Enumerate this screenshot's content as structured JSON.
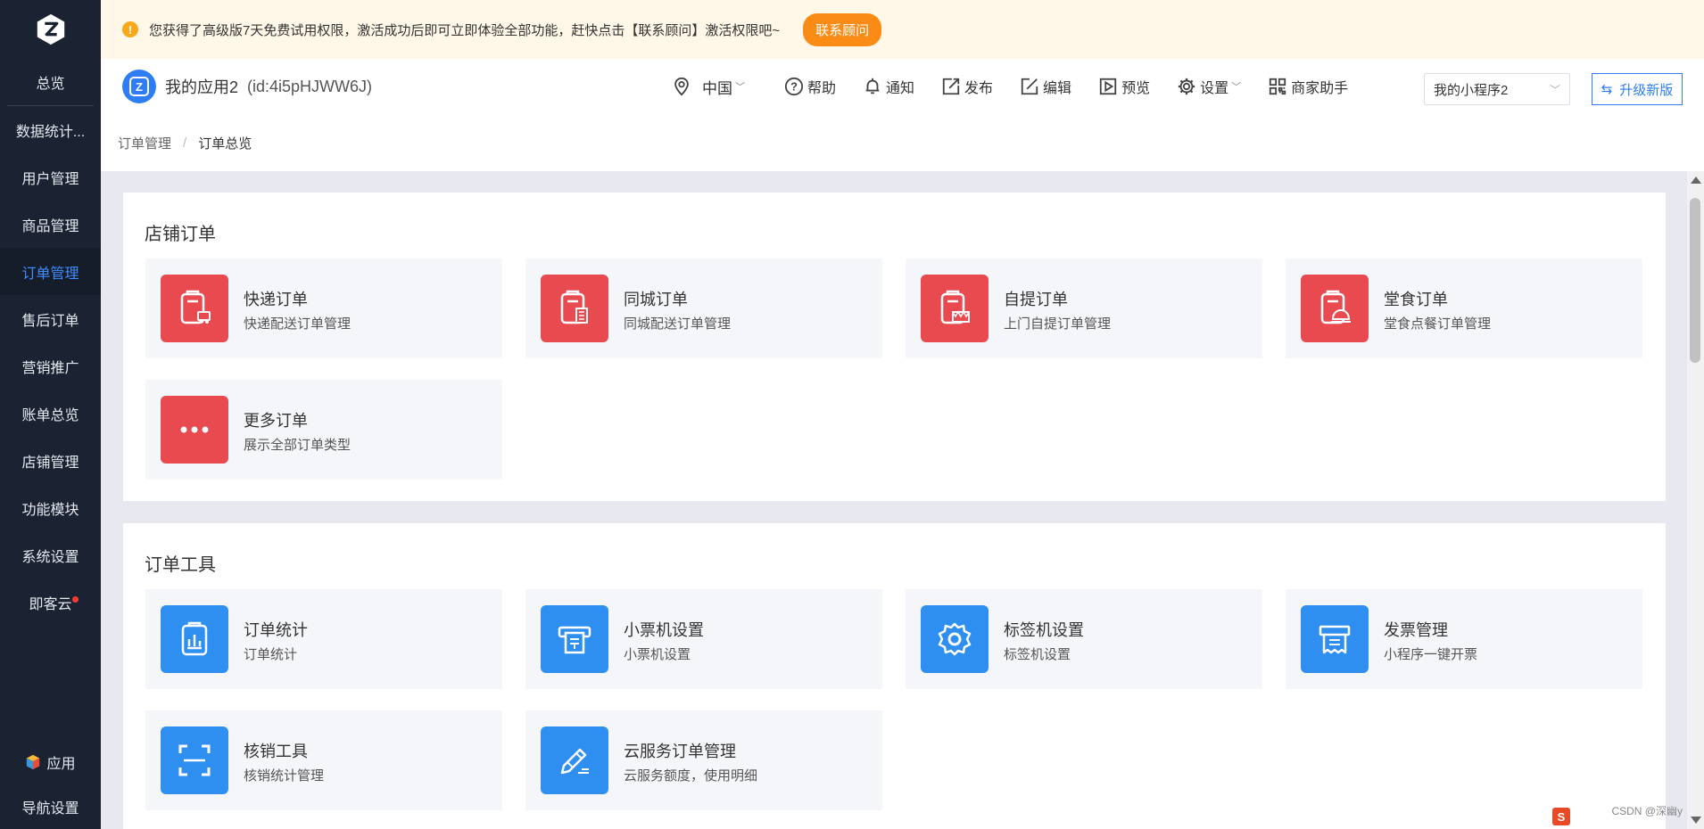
{
  "sidebar": {
    "items": [
      {
        "label": "总览"
      },
      {
        "label": "数据统计..."
      },
      {
        "label": "用户管理"
      },
      {
        "label": "商品管理"
      },
      {
        "label": "订单管理",
        "active": true
      },
      {
        "label": "售后订单"
      },
      {
        "label": "营销推广"
      },
      {
        "label": "账单总览"
      },
      {
        "label": "店铺管理"
      },
      {
        "label": "功能模块"
      },
      {
        "label": "系统设置"
      },
      {
        "label": "即客云",
        "badge": true
      }
    ],
    "bottom": {
      "app_label": "应用",
      "nav_settings_label": "导航设置"
    }
  },
  "notice": {
    "text": "您获得了高级版7天免费试用权限，激活成功后即可立即体验全部功能，赶快点击【联系顾问】激活权限吧~",
    "button": "联系顾问"
  },
  "header": {
    "app_name": "我的应用2",
    "app_id": "(id:4i5pHJWW6J)",
    "region": "中国",
    "tools": {
      "help": "帮助",
      "notify": "通知",
      "publish": "发布",
      "edit": "编辑",
      "preview": "预览",
      "settings": "设置",
      "merchant": "商家助手"
    },
    "mini_select": "我的小程序2",
    "upgrade": "升级新版"
  },
  "breadcrumb": {
    "parent": "订单管理",
    "sep": "/",
    "current": "订单总览"
  },
  "store_orders": {
    "title": "店铺订单",
    "cards": [
      {
        "title": "快递订单",
        "desc": "快递配送订单管理"
      },
      {
        "title": "同城订单",
        "desc": "同城配送订单管理"
      },
      {
        "title": "自提订单",
        "desc": "上门自提订单管理"
      },
      {
        "title": "堂食订单",
        "desc": "堂食点餐订单管理"
      },
      {
        "title": "更多订单",
        "desc": "展示全部订单类型"
      }
    ]
  },
  "order_tools": {
    "title": "订单工具",
    "cards": [
      {
        "title": "订单统计",
        "desc": "订单统计"
      },
      {
        "title": "小票机设置",
        "desc": "小票机设置"
      },
      {
        "title": "标签机设置",
        "desc": "标签机设置"
      },
      {
        "title": "发票管理",
        "desc": "小程序一键开票"
      },
      {
        "title": "核销工具",
        "desc": "核销统计管理"
      },
      {
        "title": "云服务订单管理",
        "desc": "云服务额度，使用明细"
      }
    ]
  },
  "watermark": "CSDN @深幽y",
  "colors": {
    "sidebar": "#1b2333",
    "active": "#3f8cff",
    "red_icon": "#e84a50",
    "blue_icon": "#2f8ff0",
    "notice_btn": "#fa8c16"
  }
}
